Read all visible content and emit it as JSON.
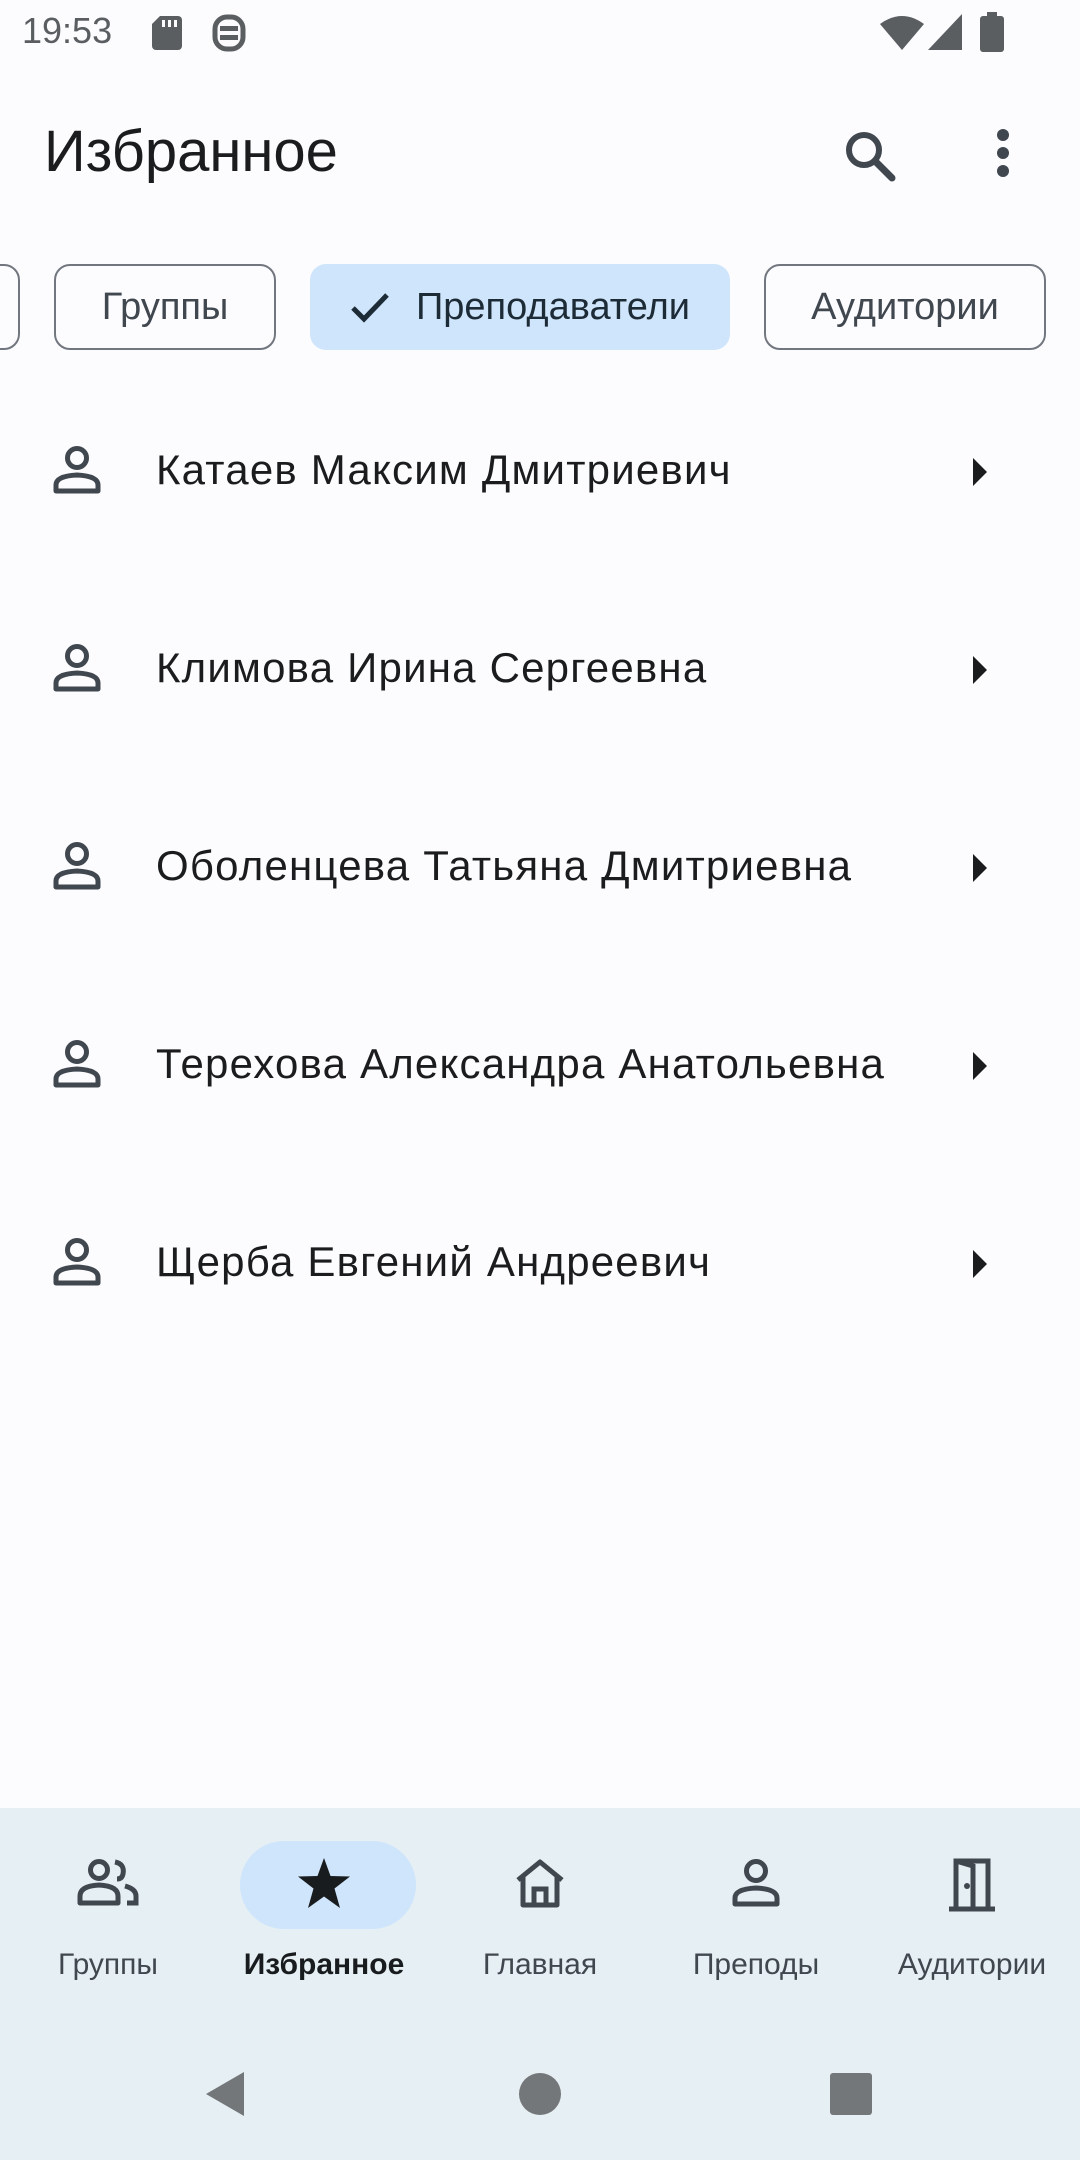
{
  "status_bar": {
    "time": "19:53",
    "left_icons": [
      "sd-card-icon",
      "data-saver-icon"
    ],
    "right_icons": [
      "wifi-icon",
      "signal-icon",
      "battery-icon"
    ]
  },
  "app_bar": {
    "title": "Избранное",
    "actions": [
      "search-icon",
      "more-vert-icon"
    ]
  },
  "filter_chips": [
    {
      "label": "",
      "selected": false,
      "partially_visible": true
    },
    {
      "label": "Группы",
      "selected": false
    },
    {
      "label": "Преподаватели",
      "selected": true,
      "icon": "check-icon"
    },
    {
      "label": "Аудитории",
      "selected": false
    }
  ],
  "favorites": [
    {
      "name": "Катаев Максим Дмитриевич",
      "icon": "person-icon",
      "trailing": "arrow-right-icon"
    },
    {
      "name": "Климова Ирина Сергеевна",
      "icon": "person-icon",
      "trailing": "arrow-right-icon"
    },
    {
      "name": "Оболенцева Татьяна Дмитриевна",
      "icon": "person-icon",
      "trailing": "arrow-right-icon"
    },
    {
      "name": "Терехова Александра Анатольевна",
      "icon": "person-icon",
      "trailing": "arrow-right-icon"
    },
    {
      "name": "Щерба Евгений Андреевич",
      "icon": "person-icon",
      "trailing": "arrow-right-icon"
    }
  ],
  "bottom_nav": [
    {
      "label": "Группы",
      "icon": "groups-icon",
      "active": false
    },
    {
      "label": "Избранное",
      "icon": "star-icon",
      "active": true
    },
    {
      "label": "Главная",
      "icon": "home-icon",
      "active": false
    },
    {
      "label": "Преподы",
      "icon": "person-icon",
      "active": false
    },
    {
      "label": "Аудитории",
      "icon": "door-icon",
      "active": false
    }
  ],
  "system_nav": [
    "back-icon",
    "home-circle-icon",
    "recents-icon"
  ],
  "colors": {
    "background": "#fcfcff",
    "selected_chip": "#cfe5fb",
    "nav_background": "#e6eff4",
    "text_primary": "#1a1c1e",
    "icon_gray": "#40474f"
  }
}
